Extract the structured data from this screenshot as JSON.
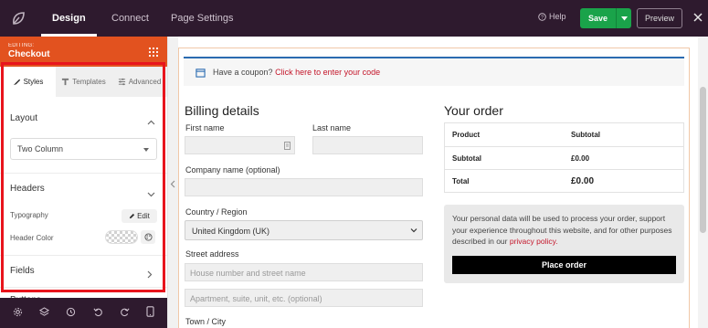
{
  "topbar": {
    "tabs": [
      "Design",
      "Connect",
      "Page Settings"
    ],
    "help": "Help",
    "save": "Save",
    "preview": "Preview"
  },
  "sidebar": {
    "editing": "EDITING:",
    "title": "Checkout",
    "tabs": [
      "Styles",
      "Templates",
      "Advanced"
    ],
    "layout": {
      "title": "Layout",
      "value": "Two Column"
    },
    "headers": {
      "title": "Headers",
      "typography": "Typography",
      "edit": "Edit",
      "header_color": "Header Color"
    },
    "fields_title": "Fields",
    "buttons_title": "Buttons"
  },
  "checkout": {
    "coupon_text": "Have a coupon?",
    "coupon_link": "Click here to enter your code",
    "billing_title": "Billing details",
    "first_name": "First name",
    "last_name": "Last name",
    "company": "Company name (optional)",
    "country_label": "Country / Region",
    "country_value": "United Kingdom (UK)",
    "street_label": "Street address",
    "street_placeholder": "House number and street name",
    "apt_placeholder": "Apartment, suite, unit, etc. (optional)",
    "town_label": "Town / City",
    "order_title": "Your order",
    "order_rows": [
      {
        "label": "Product",
        "value": "Subtotal"
      },
      {
        "label": "Subtotal",
        "value": "£0.00"
      },
      {
        "label": "Total",
        "value": "£0.00"
      }
    ],
    "privacy_text": "Your personal data will be used to process your order, support your experience throughout this website, and for other purposes described in our",
    "privacy_link": "privacy policy.",
    "place_order": "Place order"
  }
}
